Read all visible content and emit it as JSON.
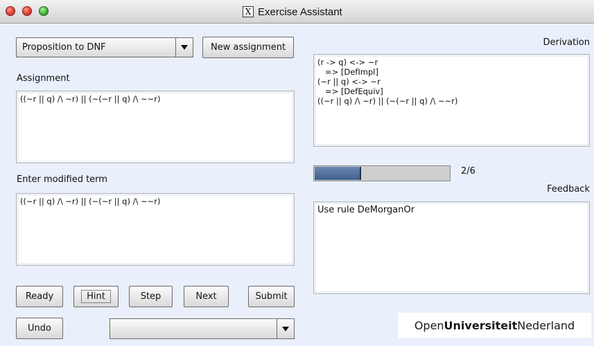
{
  "window": {
    "title": "Exercise Assistant"
  },
  "left": {
    "exercise_select": {
      "value": "Proposition to DNF"
    },
    "new_assignment_label": "New assignment",
    "assignment_label": "Assignment",
    "assignment_text": "((~r || q) /\\ ~r) || (~(~r || q) /\\ ~~r)",
    "modified_label": "Enter modified term",
    "modified_text": "((~r || q) /\\ ~r) || (~(~r || q) /\\ ~~r)",
    "buttons": {
      "ready": "Ready",
      "hint": "Hint",
      "step": "Step",
      "next": "Next",
      "submit": "Submit",
      "undo": "Undo"
    },
    "undo_select": {
      "value": ""
    }
  },
  "right": {
    "derivation_label": "Derivation",
    "derivation_text": "(r -> q) <-> ~r\n   => [DefImpl]\n(~r || q) <-> ~r\n   => [DefEquiv]\n((~r || q) /\\ ~r) || (~(~r || q) /\\ ~~r)",
    "progress": {
      "current": 2,
      "total": 6,
      "text": "2/6"
    },
    "feedback_label": "Feedback",
    "feedback_text": "Use rule DeMorganOr"
  },
  "logo": {
    "part1": "Open",
    "part2": "Universiteit",
    "part3": "Nederland"
  },
  "colors": {
    "background": "#e9f0fc",
    "progress_fill": "#3f5f8e",
    "close": "#e0443a",
    "zoom": "#49b83d"
  },
  "icons": {
    "close": "close-button-icon",
    "minimize": "minimize-button-icon",
    "zoom": "zoom-button-icon",
    "app": "x11-icon",
    "dropdown": "chevron-down-icon"
  }
}
